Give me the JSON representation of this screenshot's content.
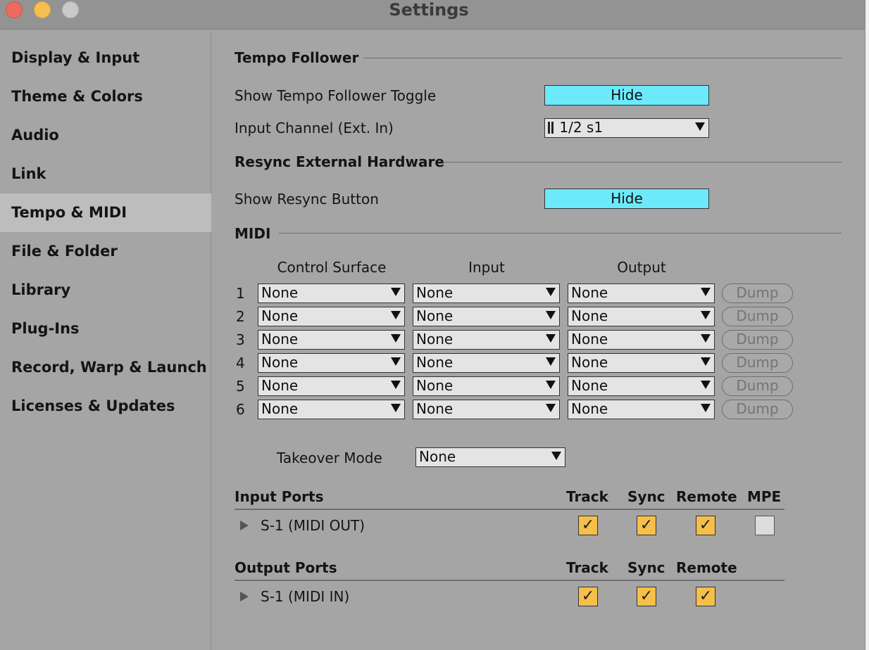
{
  "window": {
    "title": "Settings"
  },
  "sidebar": {
    "items": [
      {
        "label": "Display & Input"
      },
      {
        "label": "Theme & Colors"
      },
      {
        "label": "Audio"
      },
      {
        "label": "Link"
      },
      {
        "label": "Tempo & MIDI",
        "active": true
      },
      {
        "label": "File & Folder"
      },
      {
        "label": "Library"
      },
      {
        "label": "Plug-Ins"
      },
      {
        "label": "Record, Warp & Launch"
      },
      {
        "label": "Licenses & Updates"
      }
    ]
  },
  "tempo_follower": {
    "heading": "Tempo Follower",
    "show_toggle_label": "Show Tempo Follower Toggle",
    "show_toggle_value": "Hide",
    "input_channel_label": "Input Channel (Ext. In)",
    "input_channel_value": "1/2 s1"
  },
  "resync": {
    "heading": "Resync External Hardware",
    "show_button_label": "Show Resync Button",
    "show_button_value": "Hide"
  },
  "midi": {
    "heading": "MIDI",
    "columns": {
      "control_surface": "Control Surface",
      "input": "Input",
      "output": "Output"
    },
    "dump_label": "Dump",
    "rows": [
      {
        "num": "1",
        "control_surface": "None",
        "input": "None",
        "output": "None"
      },
      {
        "num": "2",
        "control_surface": "None",
        "input": "None",
        "output": "None"
      },
      {
        "num": "3",
        "control_surface": "None",
        "input": "None",
        "output": "None"
      },
      {
        "num": "4",
        "control_surface": "None",
        "input": "None",
        "output": "None"
      },
      {
        "num": "5",
        "control_surface": "None",
        "input": "None",
        "output": "None"
      },
      {
        "num": "6",
        "control_surface": "None",
        "input": "None",
        "output": "None"
      }
    ],
    "takeover_label": "Takeover Mode",
    "takeover_value": "None"
  },
  "input_ports": {
    "heading": "Input Ports",
    "cols": {
      "track": "Track",
      "sync": "Sync",
      "remote": "Remote",
      "mpe": "MPE"
    },
    "ports": [
      {
        "name": "S-1 (MIDI OUT)",
        "track": true,
        "sync": true,
        "remote": true,
        "mpe": false
      }
    ]
  },
  "output_ports": {
    "heading": "Output Ports",
    "cols": {
      "track": "Track",
      "sync": "Sync",
      "remote": "Remote"
    },
    "ports": [
      {
        "name": "S-1 (MIDI IN)",
        "track": true,
        "sync": true,
        "remote": true
      }
    ]
  },
  "check_glyph": "✓",
  "colors": {
    "toggle_active": "#6ceafc",
    "checkbox_on": "#f5bf4a",
    "sidebar_active": "#bdbdbd",
    "background": "#a5a5a5"
  }
}
